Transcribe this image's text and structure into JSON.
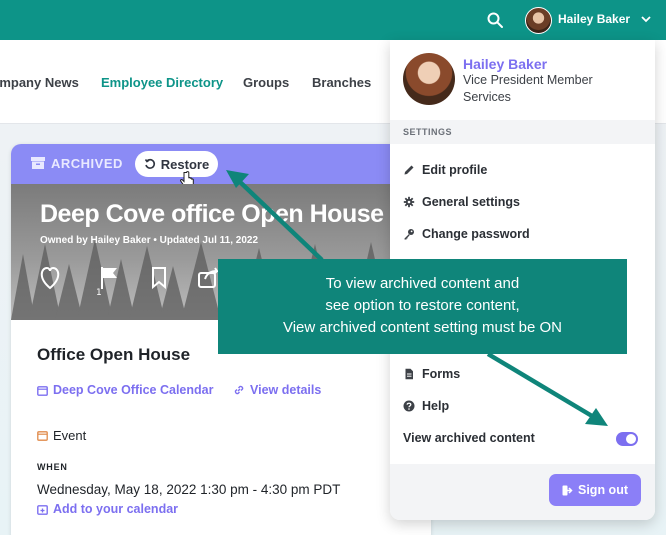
{
  "topbar": {
    "user_name": "Hailey Baker"
  },
  "nav": {
    "items": [
      {
        "label": "Company News"
      },
      {
        "label": "Employee Directory"
      },
      {
        "label": "Groups"
      },
      {
        "label": "Branches"
      }
    ]
  },
  "card": {
    "archived_label": "ARCHIVED",
    "restore_label": "Restore",
    "banner_title": "Deep Cove office Open House",
    "banner_owner": "Owned by Hailey Baker • Updated Jul 11, 2022",
    "flag_count": "1",
    "event_title": "Office Open House",
    "calendar_link": "Deep Cove Office Calendar",
    "details_link": "View details",
    "event_type": "Event",
    "when_label": "WHEN",
    "when_value": "Wednesday, May 18, 2022 1:30 pm - 4:30 pm PDT",
    "add_calendar": "Add to your calendar"
  },
  "dropdown": {
    "name": "Hailey Baker",
    "role": "Vice President Member Services",
    "settings_header": "SETTINGS",
    "edit_profile": "Edit profile",
    "general_settings": "General settings",
    "change_password": "Change password",
    "forms": "Forms",
    "help": "Help",
    "view_archived": "View archived content",
    "view_archived_on": true,
    "sign_out": "Sign out"
  },
  "callout": {
    "line1": "To view archived content and",
    "line2": "see option to restore content,",
    "line3": "View archived content setting must be ON"
  },
  "colors": {
    "teal": "#0d9488",
    "purple": "#8b8bf5",
    "link": "#7c6ff0"
  }
}
